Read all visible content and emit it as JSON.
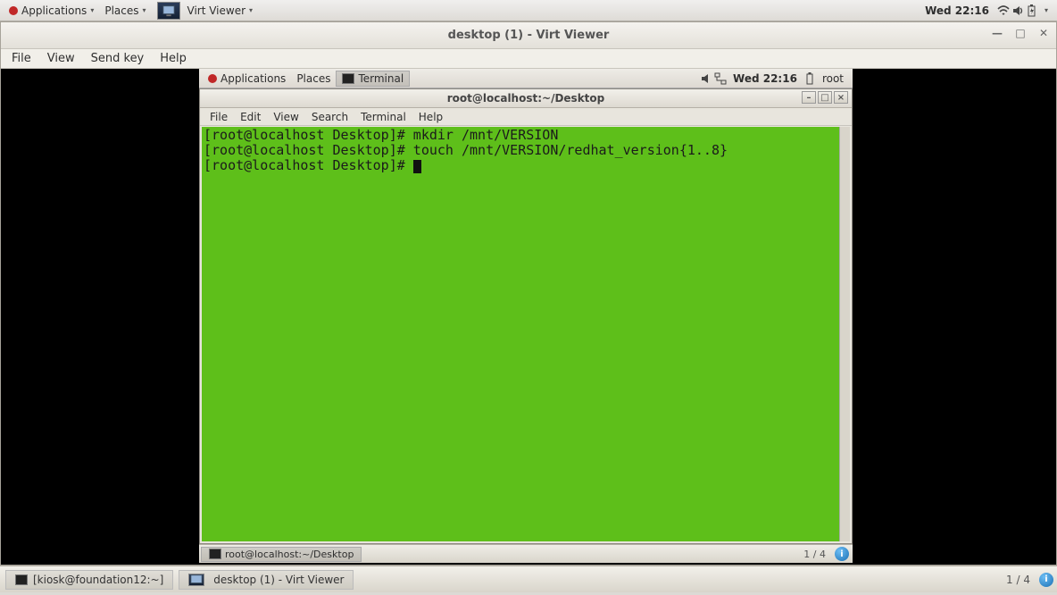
{
  "outer_panel": {
    "applications": "Applications",
    "places": "Places",
    "current_app": "Virt Viewer",
    "clock": "Wed 22:16"
  },
  "virt_viewer": {
    "title": "desktop (1) - Virt Viewer",
    "menus": {
      "file": "File",
      "view": "View",
      "sendkey": "Send key",
      "help": "Help"
    }
  },
  "guest_panel": {
    "applications": "Applications",
    "places": "Places",
    "active_app": "Terminal",
    "clock": "Wed 22:16",
    "user": "root"
  },
  "terminal_window": {
    "title": "root@localhost:~/Desktop",
    "menus": {
      "file": "File",
      "edit": "Edit",
      "view": "View",
      "search": "Search",
      "terminal": "Terminal",
      "help": "Help"
    },
    "lines": [
      {
        "prompt": "[root@localhost Desktop]# ",
        "cmd": "mkdir /mnt/VERSION"
      },
      {
        "prompt": "[root@localhost Desktop]# ",
        "cmd": "touch /mnt/VERSION/redhat_version{1..8}"
      },
      {
        "prompt": "[root@localhost Desktop]# ",
        "cmd": ""
      }
    ]
  },
  "guest_taskbar": {
    "task": "root@localhost:~/Desktop",
    "pager": "1 / 4"
  },
  "host_taskbar": {
    "task1": "[kiosk@foundation12:~]",
    "task2": "desktop (1) - Virt Viewer",
    "pager": "1 / 4"
  }
}
